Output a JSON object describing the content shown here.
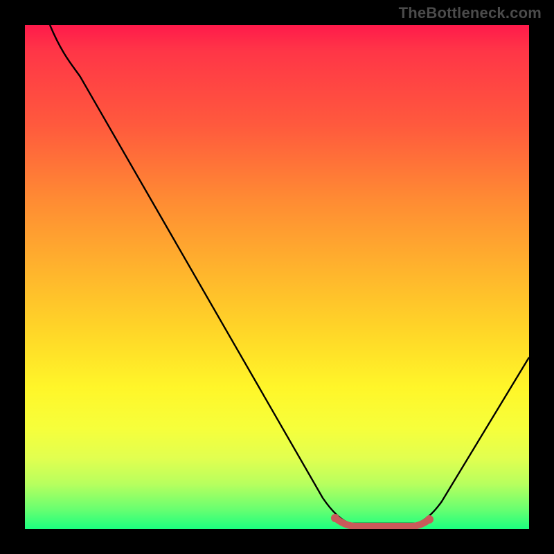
{
  "watermark": "TheBottleneck.com",
  "chart_data": {
    "type": "line",
    "title": "",
    "xlabel": "",
    "ylabel": "",
    "xlim": [
      0,
      100
    ],
    "ylim": [
      0,
      100
    ],
    "series": [
      {
        "name": "curve",
        "x": [
          5,
          10,
          20,
          30,
          40,
          50,
          58,
          62,
          68,
          72,
          78,
          85,
          92,
          100
        ],
        "values": [
          100,
          92,
          77,
          62,
          47,
          32,
          17,
          5,
          1,
          0,
          0,
          8,
          20,
          34
        ]
      }
    ],
    "optimal_band": {
      "x_start": 62,
      "x_end": 78,
      "color": "#c95a5a"
    },
    "background_gradient": {
      "stops": [
        {
          "pos": 0,
          "color": "#ff1a4b"
        },
        {
          "pos": 20,
          "color": "#ff5a3d"
        },
        {
          "pos": 48,
          "color": "#ffb22d"
        },
        {
          "pos": 72,
          "color": "#fff629"
        },
        {
          "pos": 100,
          "color": "#1bff7f"
        }
      ]
    }
  }
}
